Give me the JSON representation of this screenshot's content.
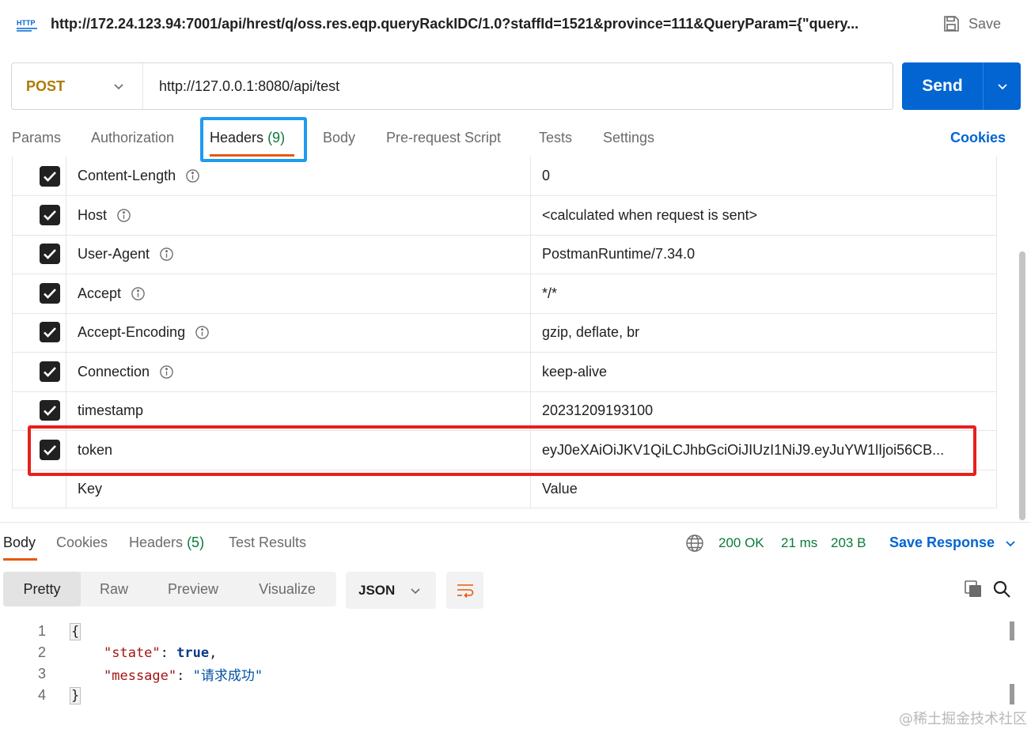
{
  "top_bar": {
    "url_title": "http://172.24.123.94:7001/api/hrest/q/oss.res.eqp.queryRackIDC/1.0?staffId=1521&province=111&QueryParam={\"query...",
    "save_label": "Save"
  },
  "request": {
    "method": "POST",
    "url": "http://127.0.0.1:8080/api/test",
    "send_label": "Send"
  },
  "request_tabs": {
    "params": "Params",
    "authorization": "Authorization",
    "headers": "Headers",
    "headers_count": "(9)",
    "body": "Body",
    "pre_request": "Pre-request Script",
    "tests": "Tests",
    "settings": "Settings",
    "cookies": "Cookies"
  },
  "headers": {
    "rows": [
      {
        "key": "Content-Length",
        "value": "0",
        "info": true
      },
      {
        "key": "Host",
        "value": "<calculated when request is sent>",
        "info": true
      },
      {
        "key": "User-Agent",
        "value": "PostmanRuntime/7.34.0",
        "info": true
      },
      {
        "key": "Accept",
        "value": "*/*",
        "info": true
      },
      {
        "key": "Accept-Encoding",
        "value": "gzip, deflate, br",
        "info": true
      },
      {
        "key": "Connection",
        "value": "keep-alive",
        "info": true
      },
      {
        "key": "timestamp",
        "value": "20231209193100",
        "info": false
      },
      {
        "key": "token",
        "value": "eyJ0eXAiOiJKV1QiLCJhbGciOiJIUzI1NiJ9.eyJuYW1lIjoi56CB...",
        "info": false
      }
    ],
    "key_placeholder": "Key",
    "value_placeholder": "Value"
  },
  "response_tabs": {
    "body": "Body",
    "cookies": "Cookies",
    "headers": "Headers",
    "headers_count": "(5)",
    "test_results": "Test Results"
  },
  "response_status": {
    "status": "200 OK",
    "time": "21 ms",
    "size": "203 B",
    "save_response": "Save Response"
  },
  "view_modes": {
    "pretty": "Pretty",
    "raw": "Raw",
    "preview": "Preview",
    "visualize": "Visualize",
    "format": "JSON"
  },
  "code": {
    "line_numbers": [
      "1",
      "2",
      "3",
      "4"
    ],
    "open_brace": "{",
    "close_brace": "}",
    "key1": "\"state\"",
    "val1": "true",
    "key2": "\"message\"",
    "val2": "\"请求成功\"",
    "colon": ": ",
    "comma": ","
  },
  "watermark": "@稀土掘金技术社区",
  "colors": {
    "accent": "#0265d2",
    "method": "#ad7a03",
    "active_tab_underline": "#e8590c",
    "count_green": "#0b7a3a",
    "highlight_blue": "#1e9bf0",
    "highlight_red": "#e5211d"
  }
}
